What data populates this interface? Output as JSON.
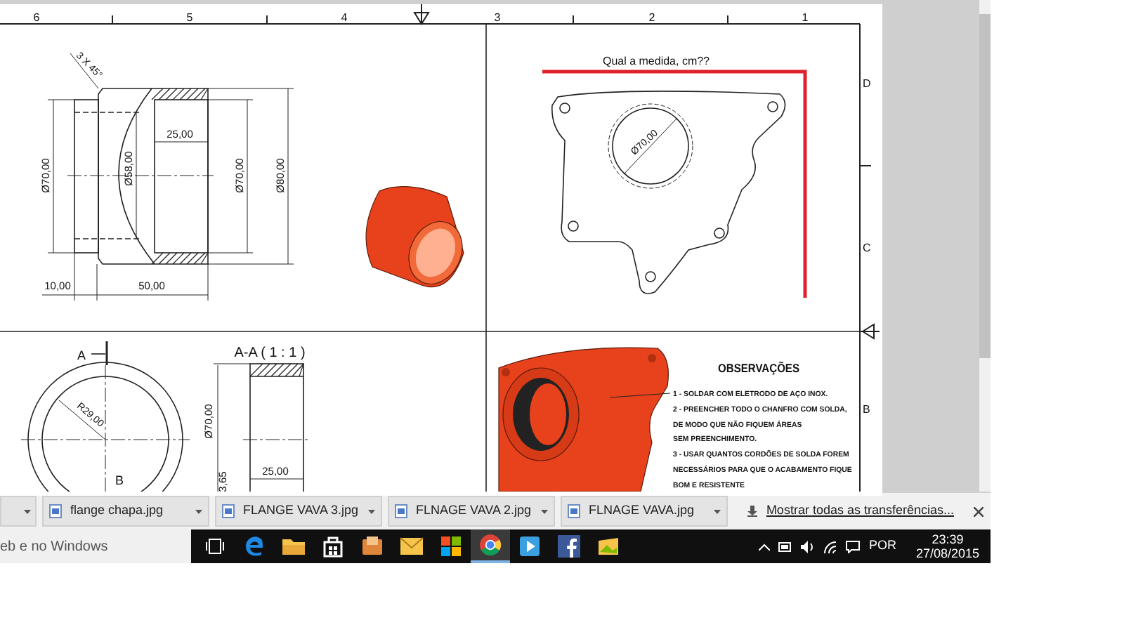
{
  "ruler": {
    "columns": [
      "6",
      "5",
      "4",
      "3",
      "2",
      "1"
    ],
    "rows": [
      "D",
      "C",
      "B"
    ]
  },
  "front_view": {
    "chamfer": "3 X 45°",
    "dims": [
      "Ø70,00",
      "Ø58,00",
      "25,00",
      "Ø70,00",
      "Ø80,00",
      "10,00",
      "50,00"
    ]
  },
  "plate_view": {
    "question": "Qual a medida, cm??",
    "diameter": "Ø70,00"
  },
  "section_view": {
    "cut_label": "A",
    "point_label": "B",
    "radius": "R29,00",
    "title": "A-A ( 1 : 1 )",
    "dims": [
      "Ø70,00",
      "3,65",
      "25,00"
    ]
  },
  "notes": {
    "title": "OBSERVAÇÕES",
    "lines": [
      "1 - SOLDAR COM ELETRODO DE AÇO INOX.",
      "2 - PREENCHER TODO O CHANFRO COM SOLDA,",
      "DE MODO QUE NÃO FIQUEM ÁREAS",
      "SEM PREENCHIMENTO.",
      "3 - USAR QUANTOS CORDÕES DE SOLDA FOREM",
      "NECESSÁRIOS PARA QUE O ACABAMENTO FIQUE",
      "BOM E RESISTENTE"
    ]
  },
  "downloads": {
    "items": [
      {
        "name": "flange chapa.jpg"
      },
      {
        "name": "FLANGE VAVA 3.jpg"
      },
      {
        "name": "FLNAGE VAVA 2.jpg"
      },
      {
        "name": "FLNAGE VAVA.jpg"
      }
    ],
    "show_all": "Mostrar todas as transferências..."
  },
  "taskbar": {
    "search": "eb e no Windows",
    "apps": [
      {
        "kind": "taskview",
        "selected": false
      },
      {
        "kind": "edge",
        "selected": false
      },
      {
        "kind": "folder",
        "selected": false
      },
      {
        "kind": "store",
        "selected": false
      },
      {
        "kind": "media",
        "selected": false
      },
      {
        "kind": "mail",
        "selected": false
      },
      {
        "kind": "office",
        "selected": false
      },
      {
        "kind": "chrome",
        "selected": true
      },
      {
        "kind": "player",
        "selected": false
      },
      {
        "kind": "facebook",
        "selected": false
      },
      {
        "kind": "photos",
        "selected": false
      }
    ],
    "language": "POR",
    "time": "23:39",
    "date": "27/08/2015"
  }
}
